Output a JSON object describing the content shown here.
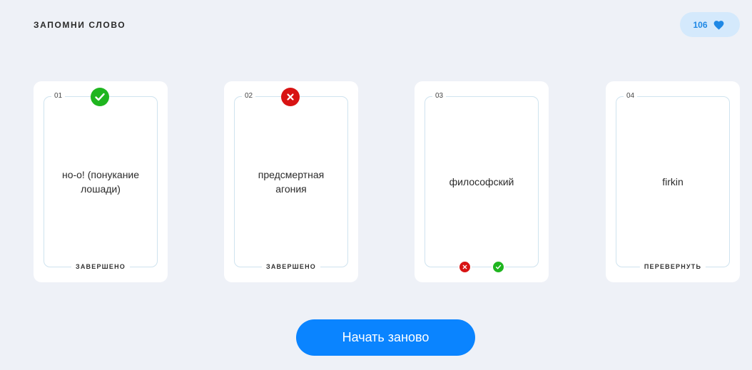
{
  "header": {
    "title": "ЗАПОМНИ СЛОВО",
    "likes_count": "106",
    "likes_icon": "heart-icon"
  },
  "cards": [
    {
      "number": "01",
      "word": "но-о! (понукание лошади)",
      "status": "ЗАВЕРШЕНО",
      "result": "correct",
      "result_icon": "check-icon"
    },
    {
      "number": "02",
      "word": "предсмертная агония",
      "status": "ЗАВЕРШЕНО",
      "result": "incorrect",
      "result_icon": "close-icon"
    },
    {
      "number": "03",
      "word": "философский",
      "status": "",
      "result": "pending",
      "actions": [
        "close-icon",
        "check-icon"
      ]
    },
    {
      "number": "04",
      "word": "firkin",
      "status": "ПЕРЕВЕРНУТЬ",
      "result": "unflipped"
    }
  ],
  "restart_button": {
    "label": "Начать заново"
  },
  "colors": {
    "background": "#eef1f7",
    "accent": "#0a84ff",
    "success": "#1fb51f",
    "error": "#d81313",
    "likes_pill": "#d4e9fc"
  }
}
